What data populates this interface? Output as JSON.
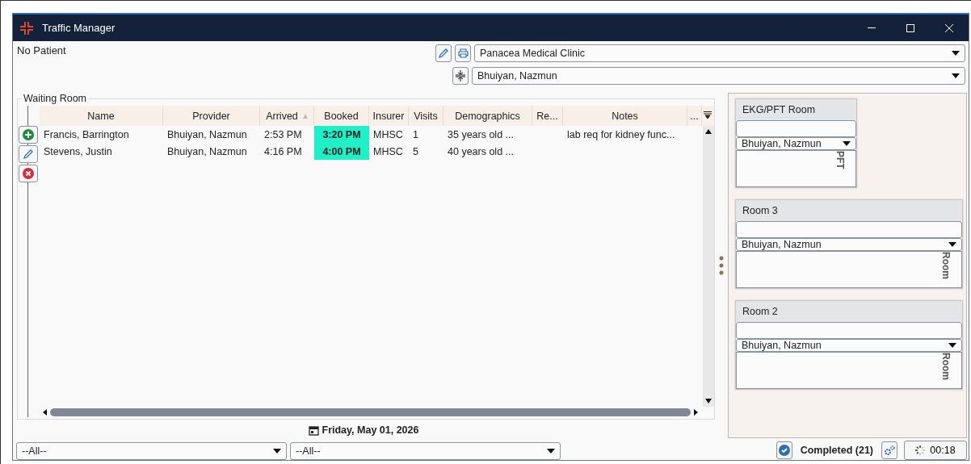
{
  "window": {
    "title": "Traffic Manager"
  },
  "patient": "No Patient",
  "clinic_select": {
    "value": "Panacea Medical Clinic"
  },
  "provider_select": {
    "value": "Bhuiyan, Nazmun"
  },
  "waiting_room": {
    "title": "Waiting Room",
    "columns": [
      {
        "label": "Name",
        "sorted": false
      },
      {
        "label": "Provider",
        "sorted": false
      },
      {
        "label": "Arrived",
        "sorted": true
      },
      {
        "label": "Booked",
        "sorted": false
      },
      {
        "label": "Insurer",
        "sorted": false
      },
      {
        "label": "Visits",
        "sorted": false
      },
      {
        "label": "Demographics",
        "sorted": false
      },
      {
        "label": "Re...",
        "sorted": false
      },
      {
        "label": "Notes",
        "sorted": false
      },
      {
        "label": "...",
        "sorted": false
      }
    ],
    "rows": [
      {
        "cells": [
          "Francis, Barrington",
          "Bhuiyan, Nazmun",
          "2:53 PM",
          "3:20 PM",
          "MHSC",
          "1",
          "35 years old ...",
          "",
          "lab req for kidney func...",
          ""
        ]
      },
      {
        "cells": [
          "Stevens, Justin",
          "Bhuiyan, Nazmun",
          "4:16 PM",
          "4:00 PM",
          "MHSC",
          "5",
          "40 years old ...",
          "",
          "",
          ""
        ]
      }
    ]
  },
  "date": "Friday, May 01, 2026",
  "filters": [
    {
      "value": "--All--"
    },
    {
      "value": "--All--"
    }
  ],
  "rooms": [
    {
      "title": "EKG/PFT Room",
      "provider": "Bhuiyan, Nazmun",
      "side_label": "PFT"
    },
    {
      "title": "Room 3",
      "provider": "Bhuiyan, Nazmun",
      "side_label": "Room"
    },
    {
      "title": "Room 2",
      "provider": "Bhuiyan, Nazmun",
      "side_label": "Room"
    }
  ],
  "status": {
    "completed": "Completed (21)",
    "timer": "00:18"
  }
}
